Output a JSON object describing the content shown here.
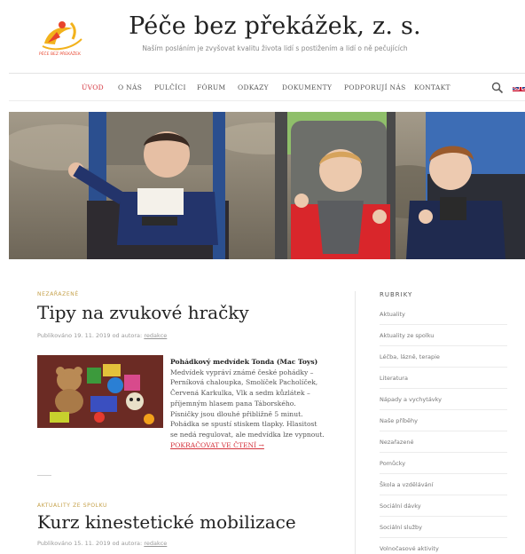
{
  "site": {
    "title": "Péče bez překážek, z. s.",
    "tagline": "Naším posláním je zvyšovat kvalitu života lidí s postižením a lidí o ně pečujících",
    "logo_text": "PÉČE BEZ PŘEKÁŽEK"
  },
  "nav": {
    "items": [
      "ÚVOD",
      "O NÁS",
      "PULČÍCI",
      "FÓRUM",
      "ODKAZY",
      "DOKUMENTY",
      "PODPORUJÍ NÁS",
      "KONTAKT"
    ],
    "active": "ÚVOD"
  },
  "posts": [
    {
      "category": "NEZAŘAZENÉ",
      "title": "Tipy na zvukové hračky",
      "meta_prefix": "Publikováno 19. 11. 2019 od autora:",
      "author": "redakce",
      "excerpt_bold": "Pohádkový medvídek Tonda (Mac Toys)",
      "excerpt": "Medvídek vypráví známé české pohádky – Perníková chaloupka, Smolíček Pacholíček, Červená Karkulka, Vlk a sedm kůzlátek – příjemným hlasem pana Táborského. Písničky jsou dlouhé přibližně 5 minut. Pohádka se spustí stiskem tlapky. Hlasitost se nedá regulovat, ale medvídka lze vypnout.",
      "read_more": "POKRAČOVAT VE ČTENÍ →"
    },
    {
      "category": "AKTUALITY ZE SPOLKU",
      "title": "Kurz kinestetické mobilizace",
      "meta_prefix": "Publikováno 15. 11. 2019 od autora:",
      "author": "redakce"
    }
  ],
  "sidebar": {
    "title": "RUBRIKY",
    "items": [
      "Aktuality",
      "Aktuality ze spolku",
      "Léčba, lázně, terapie",
      "Literatura",
      "Nápady a vychytávky",
      "Naše příběhy",
      "Nezařazené",
      "Pomůcky",
      "Škola a vzdělávání",
      "Sociální dávky",
      "Sociální služby",
      "Volnočasové aktivity"
    ]
  },
  "colors": {
    "accent_red": "#d4323c",
    "category_gold": "#c5a14a",
    "logo_yellow": "#f2b21c"
  },
  "icons": {
    "search": "search-icon",
    "language": "flag-uk-icon"
  }
}
